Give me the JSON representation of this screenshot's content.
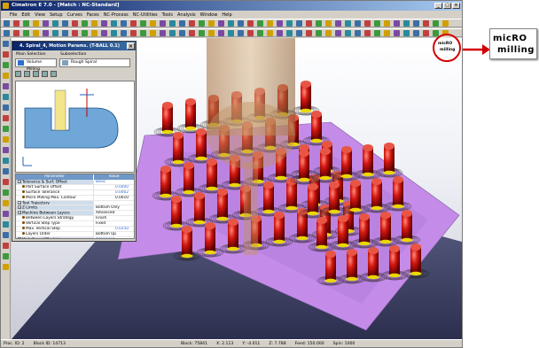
{
  "window": {
    "title": "Cimatron E 7.0 - [Match : NC-Standard]",
    "controls": [
      "_",
      "□",
      "×"
    ]
  },
  "menu": [
    "File",
    "Edit",
    "View",
    "Setup",
    "Curves",
    "Faces",
    "NC-Process",
    "NC-Utilities",
    "Tools",
    "Analysis",
    "Window",
    "Help"
  ],
  "dialog": {
    "title": "4. Spiral_4, Motion Params. (T-BALL 0.1)",
    "main_selection_label": "Main Selection",
    "subselection_label": "Subselection",
    "main_selection_value": "Volume Milling",
    "subselection_value": "Rough Spiral",
    "table": {
      "col_parameter": "Parameter",
      "col_value": "Value",
      "rows": [
        {
          "name": "Tolerance & Surf. Offset",
          "value": "Basic",
          "kind": "group-adv"
        },
        {
          "name": "Part Surface Offset",
          "value": "0.0000",
          "kind": "num"
        },
        {
          "name": "Surface Tolerance",
          "value": "0.0002",
          "kind": "num"
        },
        {
          "name": "Micro Milling Max. Contour",
          "value": "0.0010",
          "kind": "plain-right"
        },
        {
          "name": "Tool Trajectory",
          "value": "",
          "kind": "group"
        },
        {
          "name": "Z-Limits",
          "value": "Bottom Only",
          "kind": "group"
        },
        {
          "name": "Machine Between Layers",
          "value": "Advanced",
          "kind": "group"
        },
        {
          "name": "Between Layers Strategy",
          "value": "Finish",
          "kind": "item"
        },
        {
          "name": "Vertical Step Type",
          "value": "Fixed",
          "kind": "item"
        },
        {
          "name": "Max. Vertical Step",
          "value": "0.0250",
          "kind": "num"
        },
        {
          "name": "Layers Order",
          "value": "Bottom Up",
          "kind": "item"
        },
        {
          "name": "High Speed Machining",
          "value": "Advanced",
          "kind": "group-adv"
        },
        {
          "name": "Clean Between Passes",
          "value": "Advanced",
          "kind": "group"
        },
        {
          "name": "Stock & Holder Tracking",
          "value": "Advanced",
          "kind": "group"
        },
        {
          "name": "Electrode Machining",
          "value": "✓",
          "kind": "group"
        }
      ]
    }
  },
  "status": {
    "proc_id": "Proc. ID: 2",
    "block_id": "Block ID: 14713",
    "block": "Block: 75841",
    "x": "X: 2.113",
    "y": "Y: -4.011",
    "z": "Z: 7.788",
    "feed": "Feed: 150.000",
    "spin": "Spin: 1000"
  },
  "logo": {
    "line1": "micRO",
    "line2": "milling"
  },
  "colors": {
    "title_bar": "#0a246a",
    "part_magenta": "#c48ce8",
    "tool_brown": "#8a5a2a",
    "pin_red": "#d2160f",
    "callout_red": "#d20000"
  }
}
